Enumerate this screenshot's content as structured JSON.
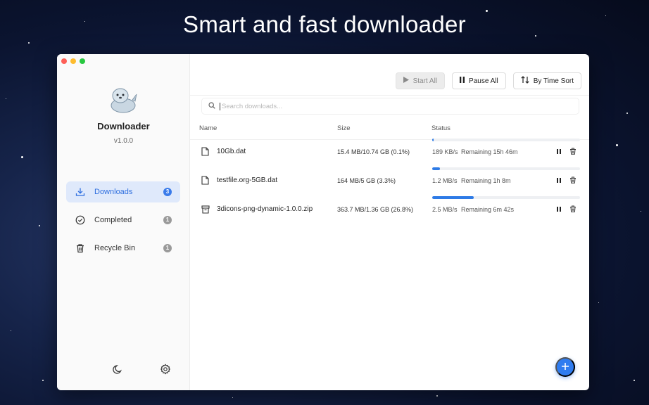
{
  "promo": {
    "headline": "Smart and fast downloader"
  },
  "window": {
    "traffic_lights": [
      "#fe5f57",
      "#febc2e",
      "#28c840"
    ]
  },
  "app": {
    "name": "Downloader",
    "version": "v1.0.0",
    "logo_icon": "seal-mascot-icon"
  },
  "sidebar": {
    "items": [
      {
        "label": "Downloads",
        "icon": "download-icon",
        "count": "3",
        "active": true
      },
      {
        "label": "Completed",
        "icon": "check-circle-icon",
        "count": "1",
        "active": false
      },
      {
        "label": "Recycle Bin",
        "icon": "trash-icon",
        "count": "1",
        "active": false
      }
    ],
    "bottom": {
      "theme_icon": "moon-icon",
      "settings_icon": "gear-icon"
    }
  },
  "toolbar": {
    "start_all": "Start All",
    "pause_all": "Pause All",
    "sort": "By Time Sort"
  },
  "search": {
    "placeholder": "Search downloads..."
  },
  "table": {
    "columns": [
      "Name",
      "Size",
      "Status"
    ],
    "rows": [
      {
        "icon": "file-icon",
        "name": "10Gb.dat",
        "size": "15.4 MB/10.74 GB (0.1%)",
        "progress": 0.01,
        "speed": "189 KB/s",
        "remaining": "Remaining 15h 46m"
      },
      {
        "icon": "file-icon",
        "name": "testfile.org-5GB.dat",
        "size": "164 MB/5 GB (3.3%)",
        "progress": 0.05,
        "speed": "1.2 MB/s",
        "remaining": "Remaining 1h 8m"
      },
      {
        "icon": "archive-icon",
        "name": "3dicons-png-dynamic-1.0.0.zip",
        "size": "363.7 MB/1.36 GB (26.8%)",
        "progress": 0.28,
        "speed": "2.5 MB/s",
        "remaining": "Remaining 6m 42s"
      }
    ]
  },
  "colors": {
    "accent": "#2e7be6",
    "active_bg": "#dfe9fb"
  }
}
